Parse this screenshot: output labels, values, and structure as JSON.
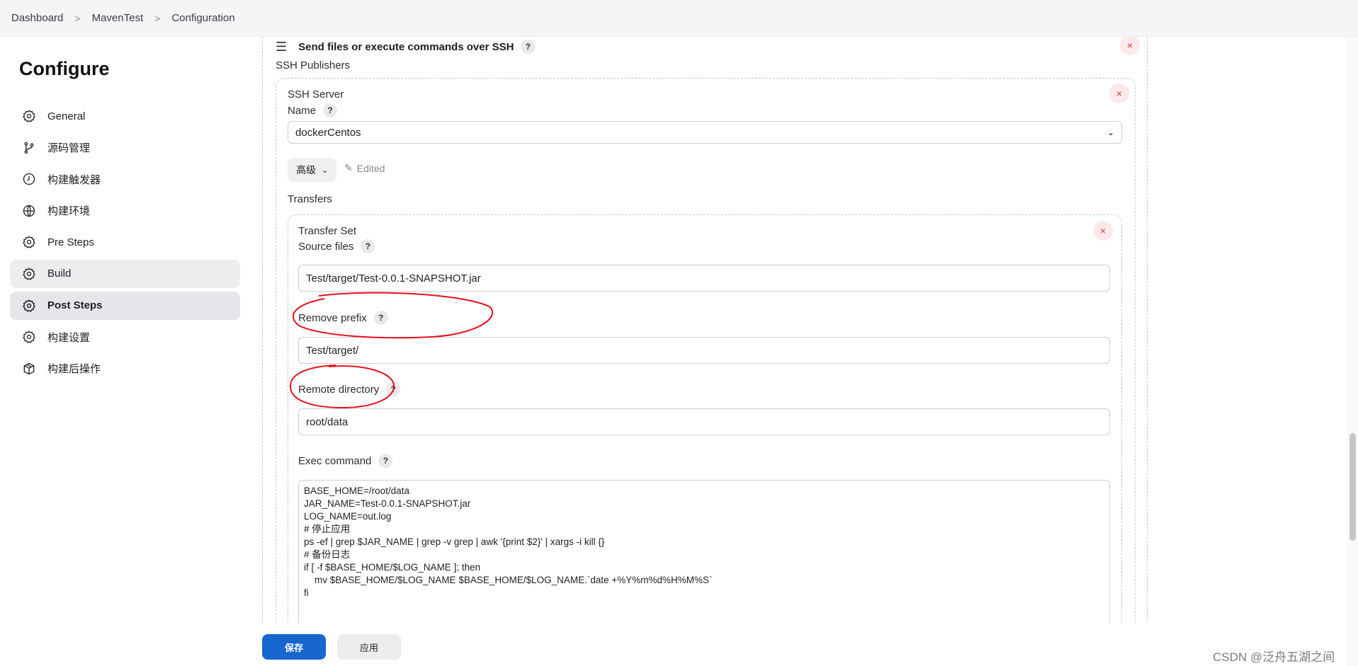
{
  "breadcrumbs": [
    "Dashboard",
    "MavenTest",
    "Configuration"
  ],
  "page_title": "Configure",
  "sidebar": {
    "items": [
      {
        "label": "General",
        "icon": "gear-icon"
      },
      {
        "label": "源码管理",
        "icon": "branch-icon"
      },
      {
        "label": "构建触发器",
        "icon": "timer-icon"
      },
      {
        "label": "构建环境",
        "icon": "globe-icon"
      },
      {
        "label": "Pre Steps",
        "icon": "gear-icon"
      },
      {
        "label": "Build",
        "icon": "gear-icon",
        "state": "hover"
      },
      {
        "label": "Post Steps",
        "icon": "gear-icon",
        "state": "active"
      },
      {
        "label": "构建设置",
        "icon": "gear-icon"
      },
      {
        "label": "构建后操作",
        "icon": "package-icon"
      }
    ]
  },
  "step": {
    "title": "Send files or execute commands over SSH",
    "help": "?",
    "close": "×",
    "publishers_label": "SSH Publishers"
  },
  "server": {
    "heading": "SSH Server",
    "name_label": "Name",
    "name_value": "dockerCentos",
    "advanced_label": "高级",
    "edited_label": "Edited",
    "transfers_label": "Transfers"
  },
  "transfer": {
    "heading": "Transfer Set",
    "source_files_label": "Source files",
    "source_files_value": "Test/target/Test-0.0.1-SNAPSHOT.jar",
    "remove_prefix_label": "Remove prefix",
    "remove_prefix_value": "Test/target/",
    "remote_directory_label": "Remote directory",
    "remote_directory_value": "root/data",
    "exec_command_label": "Exec command",
    "exec_command_value": "BASE_HOME=/root/data\nJAR_NAME=Test-0.0.1-SNAPSHOT.jar\nLOG_NAME=out.log\n# 停止应用\nps -ef | grep $JAR_NAME | grep -v grep | awk '{print $2}' | xargs -i kill {}\n# 备份日志\nif [ -f $BASE_HOME/$LOG_NAME ]; then\n    mv $BASE_HOME/$LOG_NAME $BASE_HOME/$LOG_NAME.`date +%Y%m%d%H%M%S`\nfi"
  },
  "footer": {
    "save_label": "保存",
    "apply_label": "应用"
  },
  "watermark": "CSDN @泛舟五湖之间",
  "colors": {
    "primary": "#1866cf",
    "close_red": "#e0313a",
    "annotation_red": "#e8101e"
  }
}
